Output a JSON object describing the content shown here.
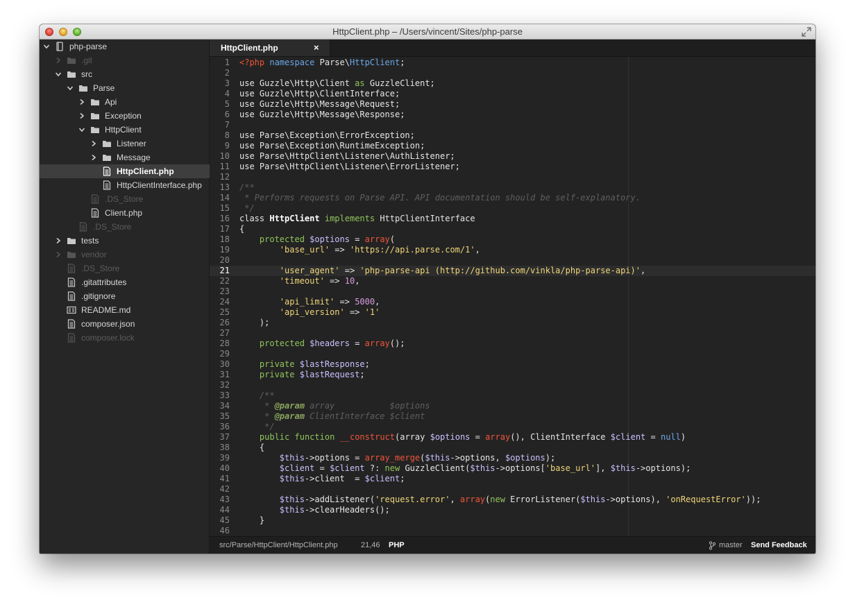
{
  "window": {
    "title": "HttpClient.php – /Users/vincent/Sites/php-parse"
  },
  "sidebar": {
    "items": [
      {
        "label": "php-parse",
        "type": "root",
        "depth": 0,
        "expanded": true,
        "dim": false
      },
      {
        "label": ".git",
        "type": "folder",
        "depth": 1,
        "expanded": false,
        "dim": true
      },
      {
        "label": "src",
        "type": "folder",
        "depth": 1,
        "expanded": true,
        "dim": false
      },
      {
        "label": "Parse",
        "type": "folder",
        "depth": 2,
        "expanded": true,
        "dim": false
      },
      {
        "label": "Api",
        "type": "folder",
        "depth": 3,
        "expanded": false,
        "dim": false
      },
      {
        "label": "Exception",
        "type": "folder",
        "depth": 3,
        "expanded": false,
        "dim": false
      },
      {
        "label": "HttpClient",
        "type": "folder",
        "depth": 3,
        "expanded": true,
        "dim": false
      },
      {
        "label": "Listener",
        "type": "folder",
        "depth": 4,
        "expanded": false,
        "dim": false
      },
      {
        "label": "Message",
        "type": "folder",
        "depth": 4,
        "expanded": false,
        "dim": false
      },
      {
        "label": "HttpClient.php",
        "type": "file",
        "depth": 4,
        "dim": false,
        "selected": true
      },
      {
        "label": "HttpClientInterface.php",
        "type": "file",
        "depth": 4,
        "dim": false
      },
      {
        "label": ".DS_Store",
        "type": "file",
        "depth": 3,
        "dim": true
      },
      {
        "label": "Client.php",
        "type": "file",
        "depth": 3,
        "dim": false
      },
      {
        "label": ".DS_Store",
        "type": "file",
        "depth": 2,
        "dim": true
      },
      {
        "label": "tests",
        "type": "folder",
        "depth": 1,
        "expanded": false,
        "dim": false
      },
      {
        "label": "vendor",
        "type": "folder",
        "depth": 1,
        "expanded": false,
        "dim": true
      },
      {
        "label": ".DS_Store",
        "type": "file",
        "depth": 1,
        "dim": true
      },
      {
        "label": ".gitattributes",
        "type": "file",
        "depth": 1,
        "dim": false
      },
      {
        "label": ".gitignore",
        "type": "file",
        "depth": 1,
        "dim": false
      },
      {
        "label": "README.md",
        "type": "markdown",
        "depth": 1,
        "dim": false
      },
      {
        "label": "composer.json",
        "type": "file",
        "depth": 1,
        "dim": false
      },
      {
        "label": "composer.lock",
        "type": "file",
        "depth": 1,
        "dim": true
      }
    ]
  },
  "editor": {
    "tab": {
      "label": "HttpClient.php",
      "close": "×"
    },
    "current_line": 21,
    "lines": [
      [
        [
          "<?php",
          "php"
        ],
        [
          " "
        ],
        [
          "namespace",
          "blue"
        ],
        [
          " Parse\\"
        ],
        [
          "HttpClient",
          "blue"
        ],
        [
          ";"
        ]
      ],
      [],
      [
        [
          "use Guzzle\\Http\\Client "
        ],
        [
          "as",
          "kw"
        ],
        [
          " GuzzleClient;"
        ]
      ],
      [
        [
          "use Guzzle\\Http\\ClientInterface;"
        ]
      ],
      [
        [
          "use Guzzle\\Http\\Message\\Request;"
        ]
      ],
      [
        [
          "use Guzzle\\Http\\Message\\Response;"
        ]
      ],
      [],
      [
        [
          "use Parse\\Exception\\ErrorException;"
        ]
      ],
      [
        [
          "use Parse\\Exception\\RuntimeException;"
        ]
      ],
      [
        [
          "use Parse\\HttpClient\\Listener\\AuthListener;"
        ]
      ],
      [
        [
          "use Parse\\HttpClient\\Listener\\ErrorListener;"
        ]
      ],
      [],
      [
        [
          "/**",
          "cmt"
        ]
      ],
      [
        [
          " * Performs requests on Parse API. API documentation should be self-explanatory.",
          "cmt"
        ]
      ],
      [
        [
          " */",
          "cmt"
        ]
      ],
      [
        [
          "class "
        ],
        [
          "HttpClient",
          "cls"
        ],
        [
          " "
        ],
        [
          "implements",
          "kw"
        ],
        [
          " HttpClientInterface"
        ]
      ],
      [
        [
          "{"
        ]
      ],
      [
        [
          "    "
        ],
        [
          "protected",
          "kw"
        ],
        [
          " "
        ],
        [
          "$options",
          "var"
        ],
        [
          " = "
        ],
        [
          "array",
          "red"
        ],
        [
          "("
        ]
      ],
      [
        [
          "        "
        ],
        [
          "'base_url'",
          "str"
        ],
        [
          " => "
        ],
        [
          "'https://api.parse.com/1'",
          "str"
        ],
        [
          ","
        ]
      ],
      [],
      [
        [
          "        "
        ],
        [
          "'user_agent'",
          "str"
        ],
        [
          " => "
        ],
        [
          "'php-parse-api (http://github.com/vinkla/php-parse-api)'",
          "str"
        ],
        [
          ","
        ]
      ],
      [
        [
          "        "
        ],
        [
          "'timeout'",
          "str"
        ],
        [
          " => "
        ],
        [
          "10",
          "num"
        ],
        [
          ","
        ]
      ],
      [],
      [
        [
          "        "
        ],
        [
          "'api_limit'",
          "str"
        ],
        [
          " => "
        ],
        [
          "5000",
          "num"
        ],
        [
          ","
        ]
      ],
      [
        [
          "        "
        ],
        [
          "'api_version'",
          "str"
        ],
        [
          " => "
        ],
        [
          "'1'",
          "str"
        ]
      ],
      [
        [
          "    );"
        ]
      ],
      [],
      [
        [
          "    "
        ],
        [
          "protected",
          "kw"
        ],
        [
          " "
        ],
        [
          "$headers",
          "var"
        ],
        [
          " = "
        ],
        [
          "array",
          "red"
        ],
        [
          "();"
        ]
      ],
      [],
      [
        [
          "    "
        ],
        [
          "private",
          "kw"
        ],
        [
          " "
        ],
        [
          "$lastResponse",
          "var"
        ],
        [
          ";"
        ]
      ],
      [
        [
          "    "
        ],
        [
          "private",
          "kw"
        ],
        [
          " "
        ],
        [
          "$lastRequest",
          "var"
        ],
        [
          ";"
        ]
      ],
      [],
      [
        [
          "    /**",
          "cmt"
        ]
      ],
      [
        [
          "     * ",
          "cmt"
        ],
        [
          "@param",
          "cmk"
        ],
        [
          " array           $options",
          "cmt"
        ]
      ],
      [
        [
          "     * ",
          "cmt"
        ],
        [
          "@param",
          "cmk"
        ],
        [
          " ClientInterface $client",
          "cmt"
        ]
      ],
      [
        [
          "     */",
          "cmt"
        ]
      ],
      [
        [
          "    "
        ],
        [
          "public",
          "kw"
        ],
        [
          " "
        ],
        [
          "function",
          "kw"
        ],
        [
          " "
        ],
        [
          "__construct",
          "red"
        ],
        [
          "(array "
        ],
        [
          "$options",
          "var"
        ],
        [
          " = "
        ],
        [
          "array",
          "red"
        ],
        [
          "(), ClientInterface "
        ],
        [
          "$client",
          "var"
        ],
        [
          " = "
        ],
        [
          "null",
          "blue"
        ],
        [
          ")"
        ]
      ],
      [
        [
          "    {"
        ]
      ],
      [
        [
          "        "
        ],
        [
          "$this",
          "var"
        ],
        [
          "->options = "
        ],
        [
          "array_merge",
          "red"
        ],
        [
          "("
        ],
        [
          "$this",
          "var"
        ],
        [
          "->options, "
        ],
        [
          "$options",
          "var"
        ],
        [
          ");"
        ]
      ],
      [
        [
          "        "
        ],
        [
          "$client",
          "var"
        ],
        [
          " = "
        ],
        [
          "$client",
          "var"
        ],
        [
          " ?: "
        ],
        [
          "new",
          "kw"
        ],
        [
          " GuzzleClient("
        ],
        [
          "$this",
          "var"
        ],
        [
          "->options["
        ],
        [
          "'base_url'",
          "str"
        ],
        [
          "], "
        ],
        [
          "$this",
          "var"
        ],
        [
          "->options);"
        ]
      ],
      [
        [
          "        "
        ],
        [
          "$this",
          "var"
        ],
        [
          "->client  = "
        ],
        [
          "$client",
          "var"
        ],
        [
          ";"
        ]
      ],
      [],
      [
        [
          "        "
        ],
        [
          "$this",
          "var"
        ],
        [
          "->addListener("
        ],
        [
          "'request.error'",
          "str"
        ],
        [
          ", "
        ],
        [
          "array",
          "red"
        ],
        [
          "("
        ],
        [
          "new",
          "kw"
        ],
        [
          " ErrorListener("
        ],
        [
          "$this",
          "var"
        ],
        [
          "->options), "
        ],
        [
          "'onRequestError'",
          "str"
        ],
        [
          "));"
        ]
      ],
      [
        [
          "        "
        ],
        [
          "$this",
          "var"
        ],
        [
          "->clearHeaders();"
        ]
      ],
      [
        [
          "    }"
        ]
      ],
      []
    ]
  },
  "status": {
    "path": "src/Parse/HttpClient/HttpClient.php",
    "position": "21,46",
    "syntax": "PHP",
    "branch": "master",
    "feedback": "Send Feedback"
  },
  "icons": {
    "fullscreen": "fullscreen-icon",
    "branch": "git-branch-icon",
    "folder": "folder-icon",
    "file": "file-icon",
    "markdown": "markdown-file-icon",
    "disclosure": "disclosure-arrow-icon"
  },
  "colors": {
    "background": "#232323",
    "sidebar": "#262626",
    "selection": "#3e3e3e",
    "keyword": "#92c45c",
    "builtin": "#f0553b",
    "string": "#f0d67a",
    "variable": "#c9c1ff",
    "number": "#d99ee0",
    "namespace": "#6aa6e6",
    "comment": "#5f5f5f"
  }
}
